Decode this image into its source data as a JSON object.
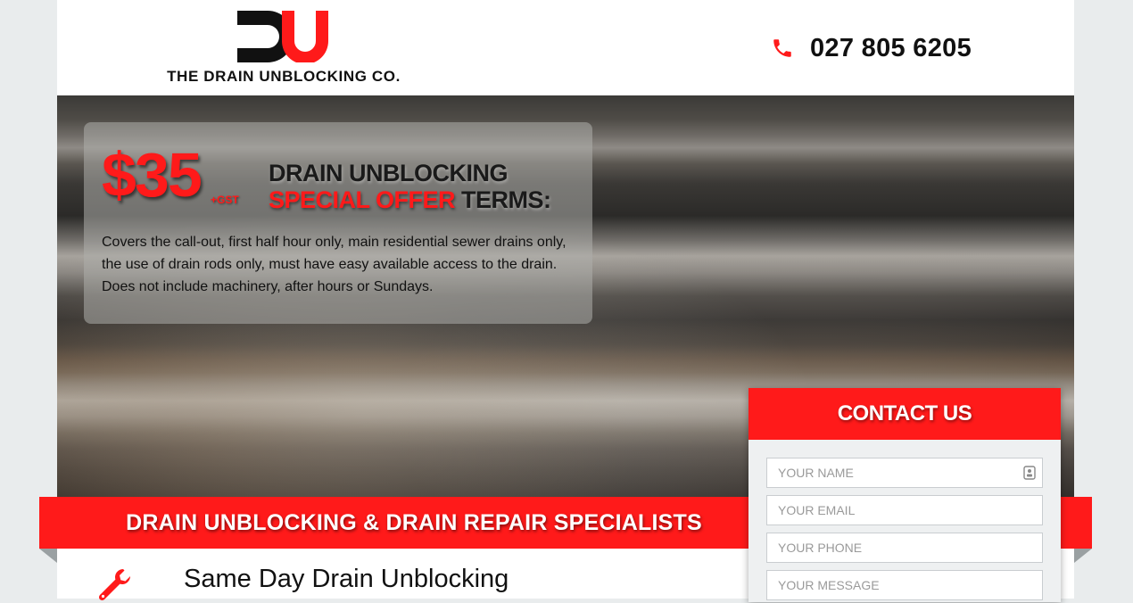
{
  "header": {
    "logo_text": "THE DRAIN UNBLOCKING CO.",
    "phone_number": "027 805 6205",
    "icons": {
      "phone": "phone-icon"
    }
  },
  "hero": {
    "price": "$35",
    "price_suffix": "+GST",
    "title_line1": "DRAIN UNBLOCKING",
    "title_highlight": "SPECIAL OFFER",
    "title_rest": " TERMS:",
    "description": "Covers the call-out, first half hour only, main residential sewer drains only, the use of drain rods only, must have easy available access to the drain. Does not include machinery, after hours or Sundays."
  },
  "ribbon": {
    "text": "DRAIN UNBLOCKING & DRAIN REPAIR SPECIALISTS"
  },
  "section": {
    "title": "Same Day Drain Unblocking",
    "icon": "wrench-icon"
  },
  "contact": {
    "heading": "CONTACT US",
    "name_placeholder": "YOUR NAME",
    "email_placeholder": "YOUR EMAIL",
    "phone_placeholder": "YOUR PHONE",
    "message_placeholder": "YOUR MESSAGE"
  },
  "colors": {
    "accent": "#ff1a1a",
    "text_dark": "#111111",
    "background": "#e9eced"
  }
}
